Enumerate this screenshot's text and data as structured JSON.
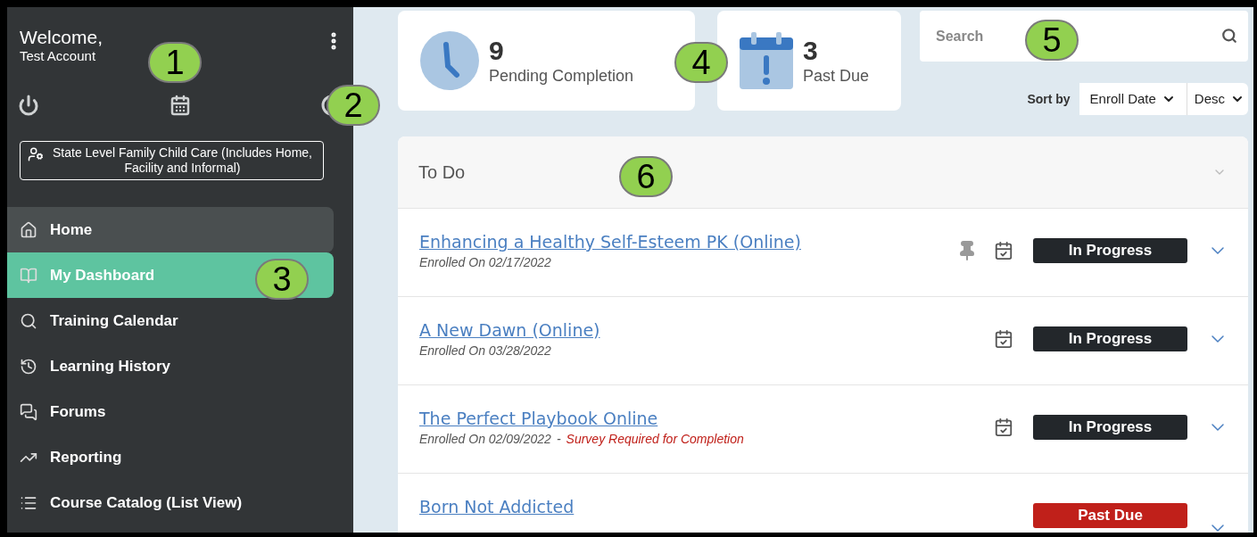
{
  "sidebar": {
    "welcome": "Welcome,",
    "user": "Test Account",
    "role": "State Level Family Child Care (Includes Home, Facility and Informal)",
    "items": [
      {
        "label": "Home",
        "selected": false,
        "hovered": true
      },
      {
        "label": "My Dashboard",
        "selected": true,
        "hovered": false
      },
      {
        "label": "Training Calendar",
        "selected": false,
        "hovered": false
      },
      {
        "label": "Learning History",
        "selected": false,
        "hovered": false
      },
      {
        "label": "Forums",
        "selected": false,
        "hovered": false
      },
      {
        "label": "Reporting",
        "selected": false,
        "hovered": false
      },
      {
        "label": "Course Catalog (List View)",
        "selected": false,
        "hovered": false
      }
    ]
  },
  "stats": [
    {
      "kind": "clock",
      "count": "9",
      "label": "Pending Completion"
    },
    {
      "kind": "calendar",
      "count": "3",
      "label": "Past Due"
    }
  ],
  "search": {
    "placeholder": "Search"
  },
  "sort": {
    "label": "Sort by",
    "field": "Enroll Date",
    "order": "Desc"
  },
  "todo": {
    "title": "To Do",
    "expanded": false,
    "rows": [
      {
        "title": "Enhancing a Healthy Self-Esteem PK (Online)",
        "enrolled": "Enrolled On 02/17/2022",
        "pinned": true,
        "calendar": true,
        "status": {
          "kind": "in_progress",
          "label": "In Progress"
        }
      },
      {
        "title": "A New Dawn (Online)",
        "enrolled": "Enrolled On 03/28/2022",
        "pinned": false,
        "calendar": true,
        "status": {
          "kind": "in_progress",
          "label": "In Progress"
        }
      },
      {
        "title": "The Perfect Playbook Online",
        "enrolled": "Enrolled On 02/09/2022",
        "separator": "-",
        "note": "Survey Required for Completion",
        "pinned": false,
        "calendar": true,
        "status": {
          "kind": "in_progress",
          "label": "In Progress"
        }
      },
      {
        "title": "Born Not Addicted",
        "pinned": false,
        "calendar": false,
        "status": {
          "kind": "past_due",
          "label": "Past Due"
        }
      }
    ]
  },
  "callouts": [
    "1",
    "2",
    "3",
    "4",
    "5",
    "6"
  ]
}
